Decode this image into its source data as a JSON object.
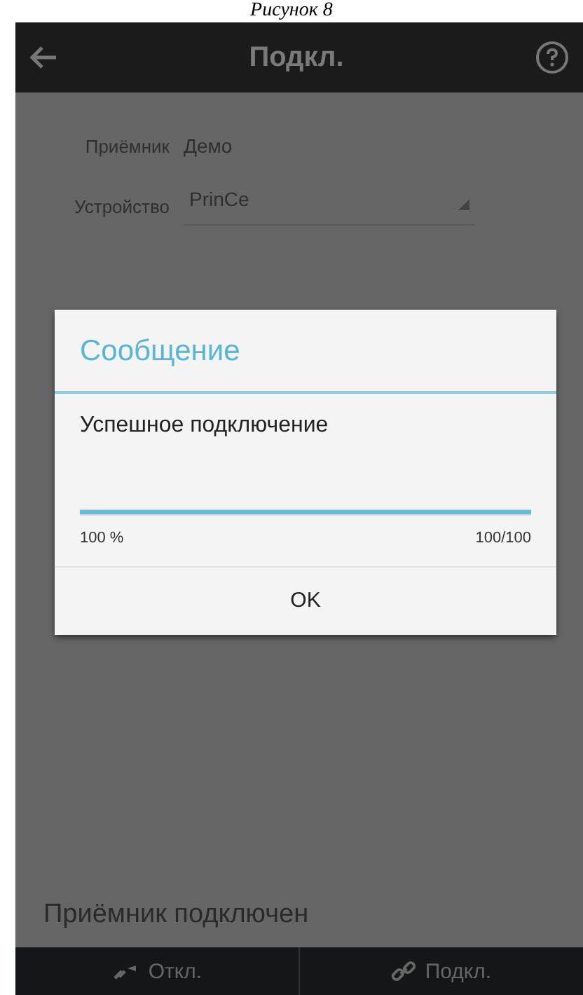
{
  "caption": "Рисунок 8",
  "header": {
    "title": "Подкл."
  },
  "fields": [
    {
      "label": "Приёмник",
      "value": "Демо",
      "kind": "text"
    },
    {
      "label": "Устройство",
      "value": "PrinCe",
      "kind": "dropdown"
    }
  ],
  "status": "Приёмник подключен",
  "dialog": {
    "title": "Сообщение",
    "message": "Успешное подключение",
    "progress": {
      "level": 1,
      "percent": "100 %",
      "count": "100/100"
    },
    "button": "OK"
  },
  "bottom_bar": [
    {
      "label": "Откл.",
      "kind": "disconnect"
    },
    {
      "label": "Подкл.",
      "kind": "connect"
    }
  ]
}
